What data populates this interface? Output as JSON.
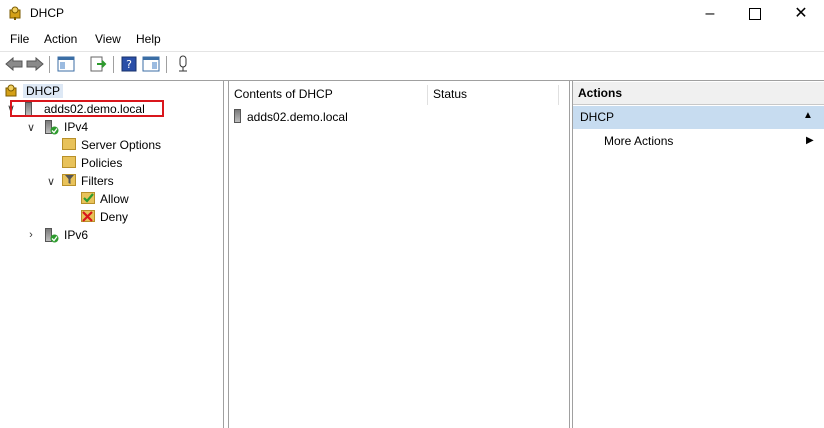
{
  "window": {
    "title": "DHCP"
  },
  "menu": [
    "File",
    "Action",
    "View",
    "Help"
  ],
  "toolbar": {
    "icons": [
      "back-arrow-icon",
      "forward-arrow-icon",
      "show-hide-console-tree-icon",
      "export-list-icon",
      "help-icon",
      "show-hide-action-pane-icon",
      "server-status-icon"
    ]
  },
  "tree": {
    "root": "DHCP",
    "server": "adds02.demo.local",
    "ipv4": "IPv4",
    "server_options": "Server Options",
    "policies": "Policies",
    "filters": "Filters",
    "allow": "Allow",
    "deny": "Deny",
    "ipv6": "IPv6"
  },
  "content": {
    "columns": [
      "Contents of DHCP",
      "Status"
    ],
    "rows": [
      {
        "name": "adds02.demo.local",
        "status": ""
      }
    ]
  },
  "actions": {
    "header": "Actions",
    "section": "DHCP",
    "items": [
      "More Actions"
    ]
  },
  "colors": {
    "highlight_border": "#d9161c",
    "actions_section_bg": "#c7dcf0",
    "actions_header_bg": "#f0f0f0"
  }
}
